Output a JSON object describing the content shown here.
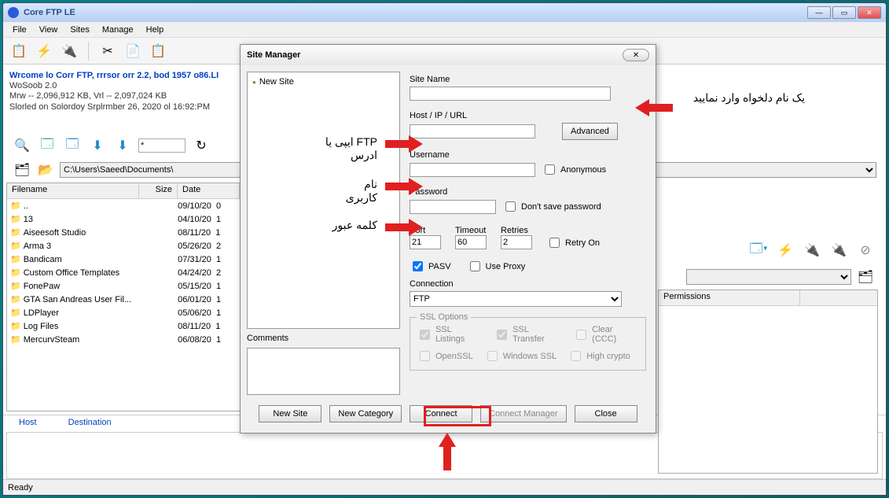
{
  "window": {
    "title": "Core FTP LE"
  },
  "menu": [
    "File",
    "View",
    "Sites",
    "Manage",
    "Help"
  ],
  "log": {
    "line1": "Wrcome lo Corr FTP, rrrsor orr 2.2, bod 1957  o86.LI",
    "line2": "WoSoob 2.0",
    "line3": "Mrw -- 2,096,912 KB, Vrl -- 2,097,024 KB",
    "line4": "Slorled on Solordoy Srplrmber 26, 2020 ol 16:92:PM"
  },
  "path": "C:\\Users\\Saeed\\Documents\\",
  "filehdr": {
    "name": "Filename",
    "size": "Size",
    "date": "Date"
  },
  "righthdr": {
    "perm": "Permissions"
  },
  "files": [
    {
      "name": "..",
      "size": "",
      "date": "09/10/20",
      "t": "0"
    },
    {
      "name": "13",
      "size": "",
      "date": "04/10/20",
      "t": "1"
    },
    {
      "name": "Aiseesoft Studio",
      "size": "",
      "date": "08/11/20",
      "t": "1"
    },
    {
      "name": "Arma 3",
      "size": "",
      "date": "05/26/20",
      "t": "2"
    },
    {
      "name": "Bandicam",
      "size": "",
      "date": "07/31/20",
      "t": "1"
    },
    {
      "name": "Custom Office Templates",
      "size": "",
      "date": "04/24/20",
      "t": "2"
    },
    {
      "name": "FonePaw",
      "size": "",
      "date": "05/15/20",
      "t": "1"
    },
    {
      "name": "GTA San Andreas User Fil...",
      "size": "",
      "date": "06/01/20",
      "t": "1"
    },
    {
      "name": "LDPlayer",
      "size": "",
      "date": "05/06/20",
      "t": "1"
    },
    {
      "name": "Log Files",
      "size": "",
      "date": "08/11/20",
      "t": "1"
    },
    {
      "name": "MercurvSteam",
      "size": "",
      "date": "06/08/20",
      "t": "1"
    }
  ],
  "tabs": {
    "host": "Host",
    "dest": "Destination"
  },
  "status": "Ready",
  "modal": {
    "title": "Site Manager",
    "tree_node": "New Site",
    "comments_lbl": "Comments",
    "site_name_lbl": "Site Name",
    "site_name_val": "",
    "host_lbl": "Host / IP / URL",
    "host_val": "",
    "advanced_btn": "Advanced",
    "user_lbl": "Username",
    "user_val": "",
    "anon_lbl": "Anonymous",
    "pass_lbl": "Password",
    "pass_val": "",
    "dontsave_lbl": "Don't save password",
    "port_lbl": "Port",
    "port_val": "21",
    "timeout_lbl": "Timeout",
    "timeout_val": "60",
    "retries_lbl": "Retries",
    "retries_val": "2",
    "retryon_lbl": "Retry On",
    "pasv_lbl": "PASV",
    "useproxy_lbl": "Use Proxy",
    "conn_lbl": "Connection",
    "conn_val": "FTP",
    "ssl_legend": "SSL Options",
    "ssl_listings": "SSL Listings",
    "ssl_transfer": "SSL Transfer",
    "ssl_clear": "Clear (CCC)",
    "ssl_openssl": "OpenSSL",
    "ssl_winssl": "Windows SSL",
    "ssl_high": "High crypto",
    "btn_newsite": "New Site",
    "btn_newcat": "New Category",
    "btn_connect": "Connect",
    "btn_connmgr": "Connect Manager",
    "btn_close": "Close"
  },
  "annotations": {
    "site_name": "یک نام دلخواه وارد نمایید",
    "host": "FTP ایپی یا ادرس",
    "user": "نام کاربری",
    "pass": "کلمه عبور"
  }
}
